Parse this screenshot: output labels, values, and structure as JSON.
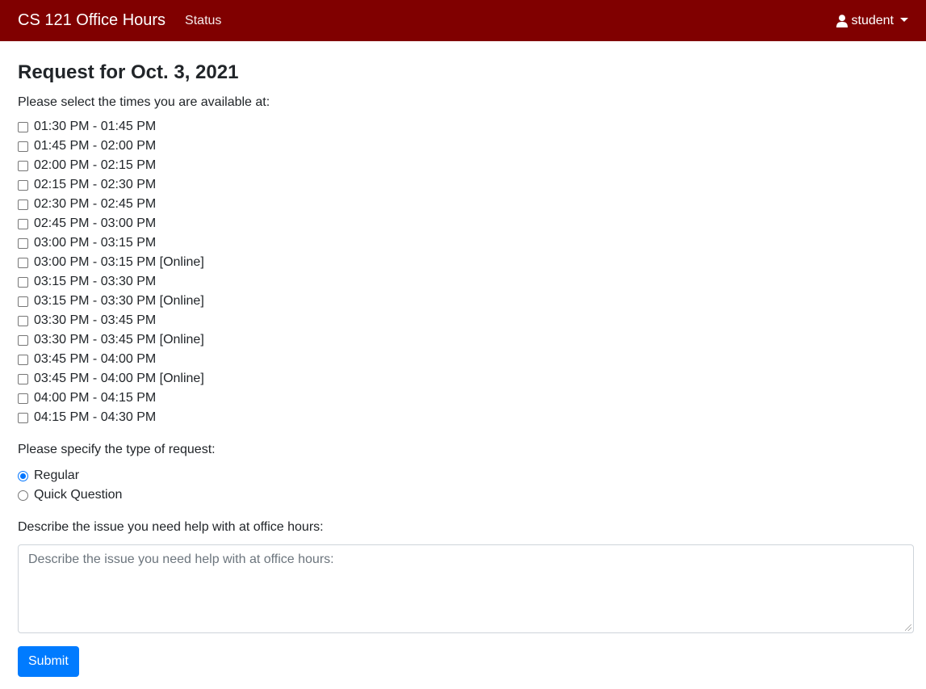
{
  "navbar": {
    "brand": "CS 121 Office Hours",
    "links": [
      "Status"
    ],
    "user": "student",
    "colors": {
      "background": "#800000"
    },
    "icons": {
      "user": "user-icon",
      "caret": "chevron-down-icon"
    }
  },
  "page": {
    "title": "Request for Oct. 3, 2021",
    "times_prompt": "Please select the times you are available at:",
    "slots": [
      "01:30 PM - 01:45 PM",
      "01:45 PM - 02:00 PM",
      "02:00 PM - 02:15 PM",
      "02:15 PM - 02:30 PM",
      "02:30 PM - 02:45 PM",
      "02:45 PM - 03:00 PM",
      "03:00 PM - 03:15 PM",
      "03:00 PM - 03:15 PM [Online]",
      "03:15 PM - 03:30 PM",
      "03:15 PM - 03:30 PM [Online]",
      "03:30 PM - 03:45 PM",
      "03:30 PM - 03:45 PM [Online]",
      "03:45 PM - 04:00 PM",
      "03:45 PM - 04:00 PM [Online]",
      "04:00 PM - 04:15 PM",
      "04:15 PM - 04:30 PM"
    ],
    "type_prompt": "Please specify the type of request:",
    "request_types": [
      {
        "label": "Regular",
        "checked": true
      },
      {
        "label": "Quick Question",
        "checked": false
      }
    ],
    "description_prompt": "Describe the issue you need help with at office hours:",
    "description_placeholder": "Describe the issue you need help with at office hours:",
    "description_value": "",
    "submit_label": "Submit",
    "colors": {
      "primary": "#007bff"
    }
  }
}
